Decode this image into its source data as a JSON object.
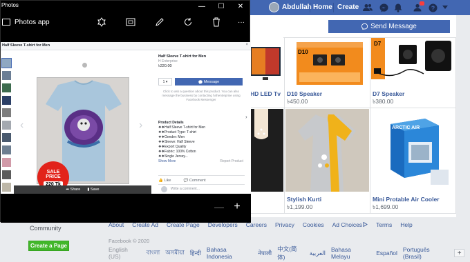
{
  "photos_app": {
    "window_title": "Photos",
    "app_name": "Photos app",
    "controls": {
      "minimize": "—",
      "maximize": "☐",
      "close": "✕"
    },
    "toolbar_icons": [
      "enhance-icon",
      "slideshow-icon",
      "edit-icon",
      "rotate-icon",
      "delete-icon",
      "more-icon"
    ],
    "more_label": "···",
    "zoom_out": "—",
    "zoom_in": "+",
    "inner": {
      "caption": "Half Sleeve T-shirt for Men",
      "product_name": "Half Sleeve T-shirt for Men",
      "seller": "H Enterprise",
      "price": "৳220.00",
      "qty": "1 ▾",
      "message_btn": "Message",
      "help_text": "Click to ask a question about this product. You can also message the business by contacting h4hentreprise using Facebook Messenger",
      "details_heading": "Product Details",
      "details_lines": [
        "❖❖Half Sleeve T-shirt for Men",
        "❖❖Product Type: T-shirt",
        "❖❖Gender: Men",
        "❖❖Sleeve: Half Sleeve",
        "❖❖Export Quality",
        "❖❖Fabric: 100% Cotton",
        "❖❖Single Jersey..."
      ],
      "see_more": "Show More",
      "report": "Report Product",
      "like": "Like",
      "comment": "Comment",
      "comment_placeholder": "Write a comment...",
      "share": "Share",
      "save": "Save",
      "sale_top": "SALE",
      "sale_mid": "PRICE",
      "sale_price": "220 Tk"
    }
  },
  "facebook": {
    "user_name": "Abdullah",
    "nav_home": "Home",
    "nav_create": "Create",
    "send_message": "Send Message",
    "products": [
      {
        "title": "HD LED Tv",
        "price": ""
      },
      {
        "title": "D10 Speaker",
        "price": "৳450.00"
      },
      {
        "title": "D7 Speaker",
        "price": "৳380.00"
      },
      {
        "title": "Stylish Kurti",
        "price": "৳1,199.00"
      },
      {
        "title": "Mini Protable Air Cooler",
        "price": "৳1,699.00"
      }
    ],
    "d10_box_label": "D10",
    "d7_box_label": "D7",
    "cooler_box_label": "ARCTIC AIR",
    "footer": {
      "community": "Community",
      "create_page": "Create a Page",
      "links": [
        "About",
        "Create Ad",
        "Create Page",
        "Developers",
        "Careers",
        "Privacy",
        "Cookies",
        "Ad Choices",
        "Terms",
        "Help"
      ],
      "copyright": "Facebook © 2020",
      "current_language": "English (US)",
      "languages": [
        "বাংলা",
        "অসমীয়া",
        "हिन्दी",
        "Bahasa Indonesia",
        "नेपाली",
        "中文(简体)",
        "العربية",
        "Bahasa Melayu",
        "Español",
        "Português (Brasil)"
      ],
      "add_language": "+"
    }
  },
  "colors": {
    "fb_blue": "#4267b2",
    "fb_green": "#42b72a",
    "sale_red": "#e2231a"
  }
}
